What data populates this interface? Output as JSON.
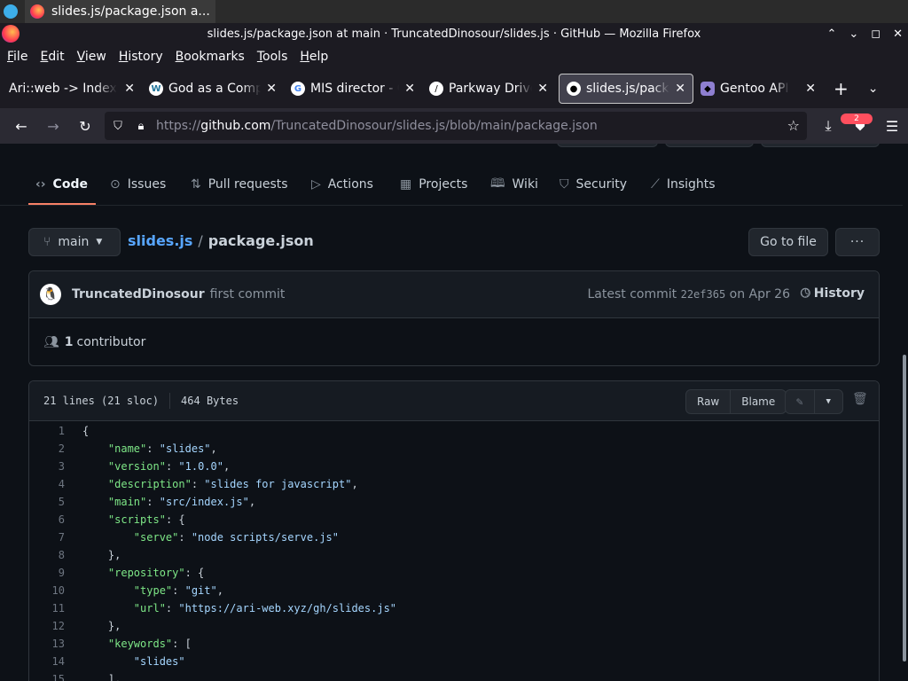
{
  "taskbar": {
    "active_title": "slides.js/package.json a..."
  },
  "window": {
    "title": "slides.js/package.json at main · TruncatedDinosour/slides.js · GitHub — Mozilla Firefox"
  },
  "menubar": {
    "items": [
      {
        "label": "File",
        "accel": "F",
        "rest": "ile"
      },
      {
        "label": "Edit",
        "accel": "E",
        "rest": "dit"
      },
      {
        "label": "View",
        "accel": "V",
        "rest": "iew"
      },
      {
        "label": "History",
        "accel": "H",
        "rest": "istory"
      },
      {
        "label": "Bookmarks",
        "accel": "B",
        "rest": "ookmarks"
      },
      {
        "label": "Tools",
        "accel": "T",
        "rest": "ools"
      },
      {
        "label": "Help",
        "accel": "H",
        "rest": "elp"
      }
    ]
  },
  "tabs": [
    {
      "label": "Ari::web -> Index",
      "icon": "none"
    },
    {
      "label": "God as a Comp",
      "icon": "wordpress-icon"
    },
    {
      "label": "MIS director - G",
      "icon": "google-icon"
    },
    {
      "label": "Parkway Drive",
      "icon": "parkway-icon"
    },
    {
      "label": "slides.js/packa",
      "icon": "github-icon",
      "active": true
    },
    {
      "label": "Gentoo API",
      "icon": "gentoo-icon"
    }
  ],
  "navbar": {
    "url_scheme": "https://",
    "url_host": "github.com",
    "url_path": "/TruncatedDinosour/slides.js/blob/main/package.json",
    "extension_badge": "2"
  },
  "repo_nav": {
    "items": [
      {
        "label": "Code",
        "icon": "code-icon",
        "selected": true
      },
      {
        "label": "Issues",
        "icon": "issue-icon"
      },
      {
        "label": "Pull requests",
        "icon": "pull-request-icon"
      },
      {
        "label": "Actions",
        "icon": "play-icon"
      },
      {
        "label": "Projects",
        "icon": "table-icon"
      },
      {
        "label": "Wiki",
        "icon": "book-icon"
      },
      {
        "label": "Security",
        "icon": "shield-icon"
      },
      {
        "label": "Insights",
        "icon": "graph-icon"
      }
    ]
  },
  "file_nav": {
    "branch": "main",
    "repo": "slides.js",
    "separator": "/",
    "file": "package.json",
    "goto_file": "Go to file",
    "more": "···"
  },
  "commit": {
    "author": "TruncatedDinosour",
    "message": "first commit",
    "latest_prefix": "Latest commit",
    "sha": "22ef365",
    "date": "on Apr 26",
    "history_label": "History",
    "contributors_count": "1",
    "contributors_label": "contributor"
  },
  "file_info": {
    "lines": "21 lines (21 sloc)",
    "size": "464 Bytes",
    "raw": "Raw",
    "blame": "Blame"
  },
  "code_lines": [
    {
      "n": "1",
      "parts": [
        [
          "p",
          "{"
        ]
      ]
    },
    {
      "n": "2",
      "parts": [
        [
          "p",
          "    "
        ],
        [
          "k",
          "\"name\""
        ],
        [
          "p",
          ": "
        ],
        [
          "s",
          "\"slides\""
        ],
        [
          "p",
          ","
        ]
      ]
    },
    {
      "n": "3",
      "parts": [
        [
          "p",
          "    "
        ],
        [
          "k",
          "\"version\""
        ],
        [
          "p",
          ": "
        ],
        [
          "s",
          "\"1.0.0\""
        ],
        [
          "p",
          ","
        ]
      ]
    },
    {
      "n": "4",
      "parts": [
        [
          "p",
          "    "
        ],
        [
          "k",
          "\"description\""
        ],
        [
          "p",
          ": "
        ],
        [
          "s",
          "\"slides for javascript\""
        ],
        [
          "p",
          ","
        ]
      ]
    },
    {
      "n": "5",
      "parts": [
        [
          "p",
          "    "
        ],
        [
          "k",
          "\"main\""
        ],
        [
          "p",
          ": "
        ],
        [
          "s",
          "\"src/index.js\""
        ],
        [
          "p",
          ","
        ]
      ]
    },
    {
      "n": "6",
      "parts": [
        [
          "p",
          "    "
        ],
        [
          "k",
          "\"scripts\""
        ],
        [
          "p",
          ": {"
        ]
      ]
    },
    {
      "n": "7",
      "parts": [
        [
          "p",
          "        "
        ],
        [
          "k",
          "\"serve\""
        ],
        [
          "p",
          ": "
        ],
        [
          "s",
          "\"node scripts/serve.js\""
        ]
      ]
    },
    {
      "n": "8",
      "parts": [
        [
          "p",
          "    },"
        ]
      ]
    },
    {
      "n": "9",
      "parts": [
        [
          "p",
          "    "
        ],
        [
          "k",
          "\"repository\""
        ],
        [
          "p",
          ": {"
        ]
      ]
    },
    {
      "n": "10",
      "parts": [
        [
          "p",
          "        "
        ],
        [
          "k",
          "\"type\""
        ],
        [
          "p",
          ": "
        ],
        [
          "s",
          "\"git\""
        ],
        [
          "p",
          ","
        ]
      ]
    },
    {
      "n": "11",
      "parts": [
        [
          "p",
          "        "
        ],
        [
          "k",
          "\"url\""
        ],
        [
          "p",
          ": "
        ],
        [
          "s",
          "\"https://ari-web.xyz/gh/slides.js\""
        ]
      ]
    },
    {
      "n": "12",
      "parts": [
        [
          "p",
          "    },"
        ]
      ]
    },
    {
      "n": "13",
      "parts": [
        [
          "p",
          "    "
        ],
        [
          "k",
          "\"keywords\""
        ],
        [
          "p",
          ": ["
        ]
      ]
    },
    {
      "n": "14",
      "parts": [
        [
          "p",
          "        "
        ],
        [
          "s",
          "\"slides\""
        ]
      ]
    },
    {
      "n": "15",
      "parts": [
        [
          "p",
          "    ],"
        ]
      ]
    }
  ],
  "colors": {
    "accent": "#f78166",
    "link": "#58a6ff",
    "json_key": "#7ee787",
    "json_string": "#a5d6ff",
    "bg": "#0d1117"
  }
}
